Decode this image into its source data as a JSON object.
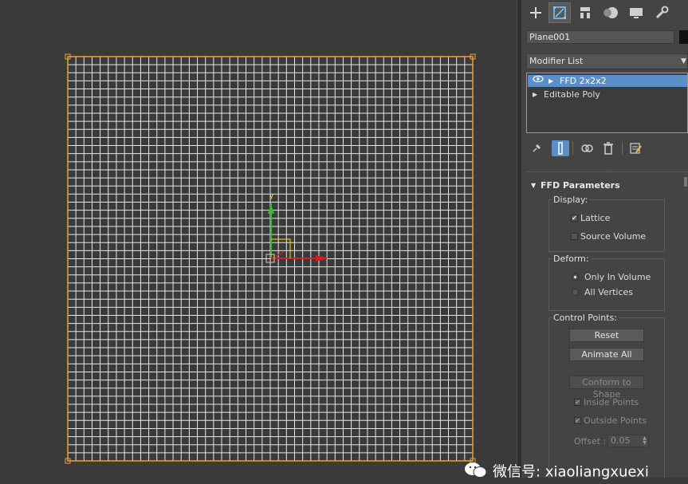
{
  "viewport": {
    "axis_x_label": "",
    "axis_y_label": "y",
    "grid_color": "#e8e8e8",
    "selection_color": "#f0a030",
    "background": "#3a3a3a"
  },
  "command_panel": {
    "tabs": [
      {
        "icon": "create-plus-icon"
      },
      {
        "icon": "modify-icon",
        "active": true
      },
      {
        "icon": "hierarchy-icon"
      },
      {
        "icon": "motion-icon"
      },
      {
        "icon": "display-icon"
      },
      {
        "icon": "utilities-wrench-icon"
      }
    ],
    "object_name": "Plane001",
    "object_color": "#111111",
    "modifier_list_label": "Modifier List",
    "stack": [
      {
        "label": "FFD 2x2x2",
        "selected": true
      },
      {
        "label": "Editable Poly",
        "selected": false
      }
    ],
    "accent_color": "#5b8fc9"
  },
  "ffd_params": {
    "title": "FFD Parameters",
    "display": {
      "title": "Display:",
      "lattice_label": "Lattice",
      "lattice_checked": true,
      "source_volume_label": "Source Volume",
      "source_volume_checked": false
    },
    "deform": {
      "title": "Deform:",
      "only_in_volume_label": "Only In Volume",
      "all_vertices_label": "All Vertices",
      "selected": "Only In Volume"
    },
    "control_points": {
      "title": "Control Points:",
      "reset_label": "Reset",
      "animate_all_label": "Animate All",
      "conform_label": "Conform to Shape",
      "inside_points_label": "Inside Points",
      "outside_points_label": "Outside Points",
      "offset_label": "Offset :",
      "offset_value": "0.05"
    }
  },
  "watermark": {
    "text": "微信号: xiaoliangxuexi"
  }
}
